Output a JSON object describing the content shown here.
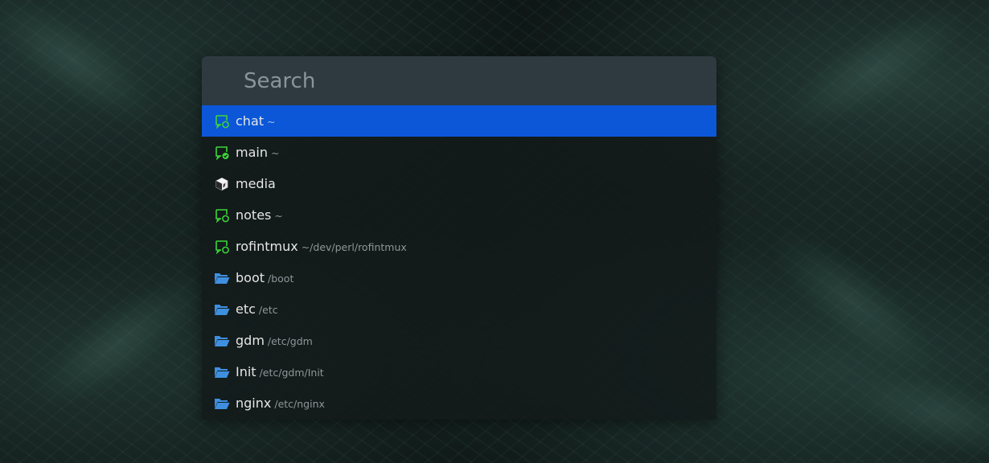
{
  "search": {
    "placeholder": "Search",
    "value": ""
  },
  "results": [
    {
      "name": "chat",
      "path": "~",
      "icon": "terminal-session-icon",
      "selected": true
    },
    {
      "name": "main",
      "path": "~",
      "icon": "terminal-attached-icon",
      "selected": false
    },
    {
      "name": "media",
      "path": "",
      "icon": "box-icon",
      "selected": false
    },
    {
      "name": "notes",
      "path": "~",
      "icon": "terminal-session-icon",
      "selected": false
    },
    {
      "name": "rofintmux",
      "path": "~/dev/perl/rofintmux",
      "icon": "terminal-session-icon",
      "selected": false
    },
    {
      "name": "boot",
      "path": "/boot",
      "icon": "folder-open-icon",
      "selected": false
    },
    {
      "name": "etc",
      "path": "/etc",
      "icon": "folder-open-icon",
      "selected": false
    },
    {
      "name": "gdm",
      "path": "/etc/gdm",
      "icon": "folder-open-icon",
      "selected": false
    },
    {
      "name": "Init",
      "path": "/etc/gdm/Init",
      "icon": "folder-open-icon",
      "selected": false
    },
    {
      "name": "nginx",
      "path": "/etc/nginx",
      "icon": "folder-open-icon",
      "selected": false
    }
  ],
  "colors": {
    "selection": "#0b57d8",
    "session_green": "#3dd639",
    "folder_blue": "#3f8fe0",
    "search_bar": "#2f3a40",
    "text": "#e6e6e6",
    "secondary_text": "#8e9699"
  }
}
